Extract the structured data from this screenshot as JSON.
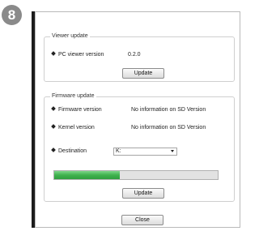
{
  "step_number": "8",
  "viewer_update": {
    "title": "Viewer update",
    "pc_viewer_version_label": "PC viewer version",
    "pc_viewer_version_value": "0.2.0",
    "update_button": "Update"
  },
  "firmware_update": {
    "title": "Firmware update",
    "firmware_version_label": "Firmware version",
    "firmware_version_value": "No information on SD Version",
    "kernel_version_label": "Kernel version",
    "kernel_version_value": "No information on SD Version",
    "destination_label": "Destination",
    "destination_value": "K:",
    "progress_fraction": 0.4,
    "update_button": "Update"
  },
  "close_button": "Close",
  "colors": {
    "progress_fill": "#3fb24e",
    "badge": "#8a8a8a"
  }
}
